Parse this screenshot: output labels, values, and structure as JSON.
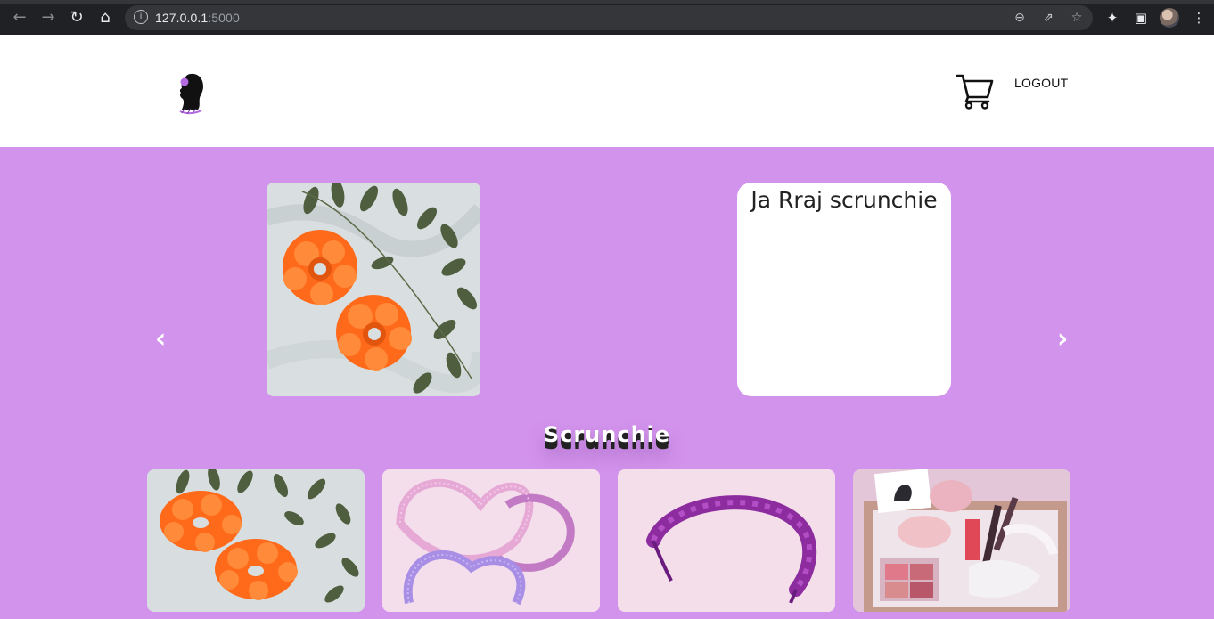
{
  "browser": {
    "url_host": "127.0.0.1",
    "url_port": ":5000",
    "icons": [
      "back-icon",
      "forward-icon",
      "reload-icon",
      "home-icon",
      "info-icon",
      "zoom-icon",
      "share-icon",
      "star-icon",
      "extensions-icon",
      "sidepanel-icon",
      "profile-avatar",
      "menu-icon"
    ]
  },
  "header": {
    "logo": "scrunchie-silhouette-logo",
    "cart_icon": "cart-icon",
    "logout_label": "LOGOUT"
  },
  "carousel": {
    "prev_label": "‹",
    "next_label": "›",
    "image": "orange-scrunchies-photo",
    "card_title": "Ja Rraj scrunchie"
  },
  "section": {
    "title": "Scrunchie"
  },
  "products": [
    {
      "image": "orange-scrunchies-photo"
    },
    {
      "image": "pink-lilac-elastic-headbands-photo"
    },
    {
      "image": "purple-satin-headband-photo"
    },
    {
      "image": "gift-box-photo"
    }
  ],
  "colors": {
    "page_bg": "#d293ec",
    "header_bg": "#ffffff",
    "chrome_bg": "#202124",
    "card_bg": "#ffffff"
  }
}
